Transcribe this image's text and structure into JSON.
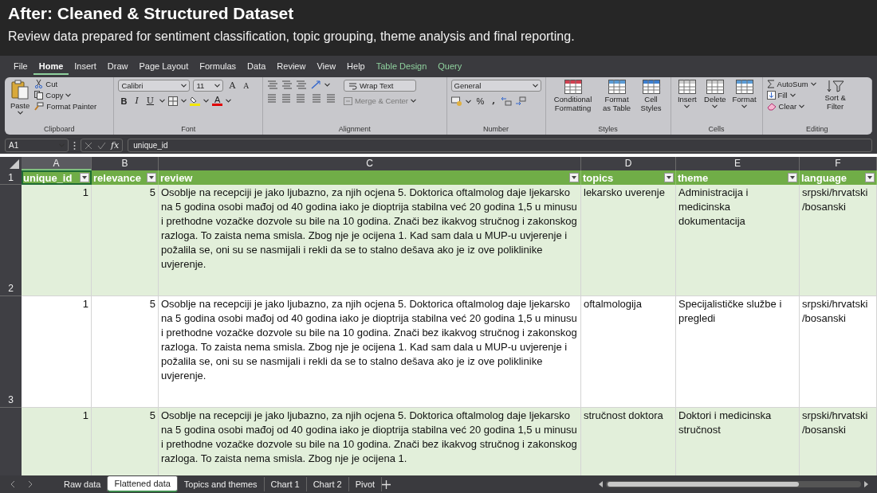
{
  "banner": {
    "title": "After: Cleaned & Structured Dataset",
    "subtitle": "Review data prepared for sentiment classification, topic grouping, theme analysis and final reporting."
  },
  "menu_tabs": [
    {
      "label": "File",
      "selected": false,
      "kind": "standard"
    },
    {
      "label": "Home",
      "selected": true,
      "kind": "standard"
    },
    {
      "label": "Insert",
      "selected": false,
      "kind": "standard"
    },
    {
      "label": "Draw",
      "selected": false,
      "kind": "standard"
    },
    {
      "label": "Page Layout",
      "selected": false,
      "kind": "standard"
    },
    {
      "label": "Formulas",
      "selected": false,
      "kind": "standard"
    },
    {
      "label": "Data",
      "selected": false,
      "kind": "standard"
    },
    {
      "label": "Review",
      "selected": false,
      "kind": "standard"
    },
    {
      "label": "View",
      "selected": false,
      "kind": "standard"
    },
    {
      "label": "Help",
      "selected": false,
      "kind": "standard"
    },
    {
      "label": "Table Design",
      "selected": false,
      "kind": "contextual"
    },
    {
      "label": "Query",
      "selected": false,
      "kind": "contextual"
    }
  ],
  "ribbon": {
    "clipboard": {
      "label": "Clipboard",
      "paste": "Paste",
      "cut": "Cut",
      "copy": "Copy",
      "format_painter": "Format Painter"
    },
    "font": {
      "label": "Font",
      "font_name": "Calibri",
      "font_size": "11",
      "grow": "A",
      "shrink": "A",
      "bold": "B",
      "italic": "I",
      "underline": "U",
      "font_color": "A"
    },
    "alignment": {
      "label": "Alignment",
      "wrap_text": "Wrap Text",
      "merge_center": {
        "label": "Merge & Center",
        "disabled": true
      }
    },
    "number": {
      "label": "Number",
      "format": "General",
      "percent": "%",
      "comma": ","
    },
    "styles": {
      "label": "Styles",
      "conditional_formatting": "Conditional Formatting",
      "format_as_table": "Format as Table",
      "cell_styles": "Cell Styles"
    },
    "cells": {
      "label": "Cells",
      "insert": "Insert",
      "delete": "Delete",
      "format": "Format"
    },
    "editing": {
      "label": "Editing",
      "autosum": "AutoSum",
      "fill": "Fill",
      "clear": "Clear",
      "sort_filter": "Sort & Filter"
    }
  },
  "formula_bar": {
    "name_box": "A1",
    "function_label": "fx",
    "formula": "unique_id"
  },
  "sheet": {
    "columns": [
      {
        "label": "A",
        "selected": true
      },
      {
        "label": "B",
        "selected": false
      },
      {
        "label": "C",
        "selected": false
      },
      {
        "label": "D",
        "selected": false
      },
      {
        "label": "E",
        "selected": false
      },
      {
        "label": "F",
        "selected": false
      }
    ],
    "header_row": {
      "number": "1",
      "cells": [
        "unique_id",
        "relevance",
        "review",
        "topics",
        "theme",
        "language"
      ]
    },
    "rows": [
      {
        "number": "2",
        "shaded": true,
        "cells": [
          "1",
          "5",
          "Osoblje na recepciji je jako ljubazno, za njih ocjena 5. Doktorica oftalmolog daje ljekarsko na 5 godina osobi mađoj od 40 godina iako je dioptrija stabilna već 20 godina 1,5 u minusu i prethodne vozačke dozvole su bile na 10 godina. Znači bez ikakvog stručnog i zakonskog razloga. To zaista nema smisla. Zbog nje je ocijena 1. Kad sam dala u MUP-u uvjerenje i požalila se, oni su se nasmijali i rekli da se to stalno dešava ako je iz ove poliklinike uvjerenje.",
          "lekarsko uverenje",
          "Administracija i medicinska dokumentacija",
          "srpski/hrvatski /bosanski"
        ]
      },
      {
        "number": "3",
        "shaded": false,
        "cells": [
          "1",
          "5",
          "Osoblje na recepciji je jako ljubazno, za njih ocjena 5. Doktorica oftalmolog daje ljekarsko na 5 godina osobi mađoj od 40 godina iako je dioptrija stabilna već 20 godina 1,5 u minusu i prethodne vozačke dozvole su bile na 10 godina. Znači bez ikakvog stručnog i zakonskog razloga. To zaista nema smisla. Zbog nje je ocijena 1. Kad sam dala u MUP-u uvjerenje i požalila se, oni su se nasmijali i rekli da se to stalno dešava ako je iz ove poliklinike uvjerenje.",
          "oftalmologija",
          "Specijalističke službe i pregledi",
          "srpski/hrvatski /bosanski"
        ]
      },
      {
        "shaded": true,
        "cells": [
          "1",
          "5",
          "Osoblje na recepciji je jako ljubazno, za njih ocjena 5. Doktorica oftalmolog daje ljekarsko na 5 godina osobi mađoj od 40 godina iako je dioptrija stabilna već 20 godina 1,5 u minusu i prethodne vozačke dozvole su bile na 10 godina. Znači bez ikakvog stručnog i zakonskog razloga. To zaista nema smisla. Zbog nje je ocijena 1.",
          "stručnost doktora",
          "Doktori i medicinska stručnost",
          "srpski/hrvatski /bosanski"
        ]
      }
    ]
  },
  "sheet_tabs": [
    {
      "label": "Raw data",
      "selected": false
    },
    {
      "label": "Flattened data",
      "selected": true
    },
    {
      "label": "Topics and themes",
      "selected": false
    },
    {
      "label": "Chart 1",
      "selected": false
    },
    {
      "label": "Chart 2",
      "selected": false
    },
    {
      "label": "Pivot",
      "selected": false
    }
  ]
}
